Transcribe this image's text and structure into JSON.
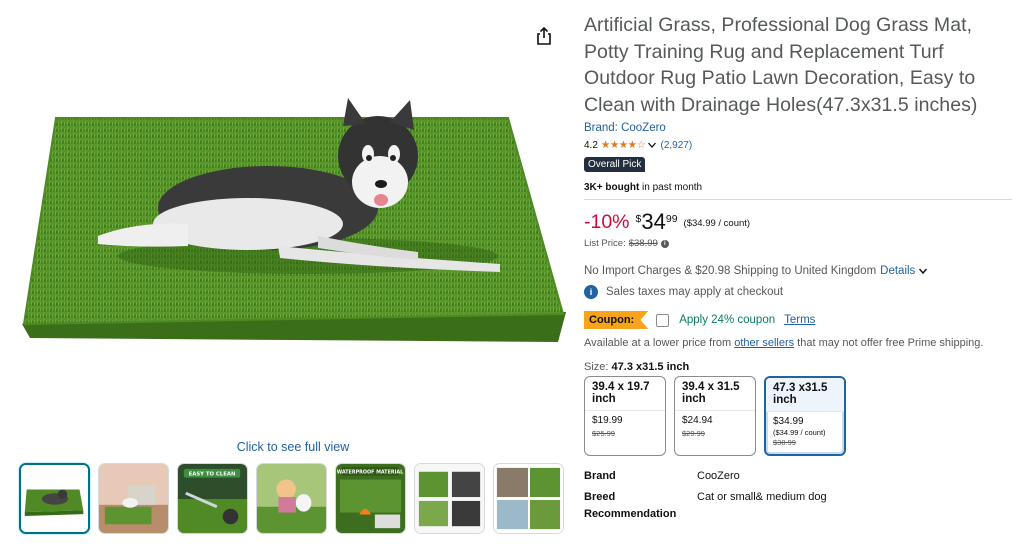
{
  "gallery": {
    "share_icon": "share-icon",
    "see_full_view": "Click to see full view",
    "thumbnails": [
      "thumbnail-1",
      "thumbnail-2",
      "thumbnail-3",
      "thumbnail-4",
      "thumbnail-5",
      "thumbnail-6",
      "thumbnail-7"
    ],
    "thumb3_text": "EASY TO CLEAN",
    "thumb5_text": "WATERPROOF MATERIAL"
  },
  "product": {
    "title": "Artificial Grass, Professional Dog Grass Mat, Potty Training Rug and Replacement Turf Outdoor Rug Patio Lawn Decoration, Easy to Clean with Drainage Holes(47.3x31.5 inches)",
    "brand_link": "Brand: CooZero",
    "rating": "4.2",
    "stars_value": 4.2,
    "rating_count": "(2,927)",
    "badge": "Overall Pick",
    "bought_bold": "3K+ bought",
    "bought_rest": " in past month"
  },
  "price": {
    "discount": "-10%",
    "currency": "$",
    "whole": "34",
    "fraction": "99",
    "per_count": "($34.99 / count)",
    "list_label": "List Price:",
    "list_value": "$38.99"
  },
  "shipping": {
    "text": "No Import Charges & $20.98 Shipping to United Kingdom",
    "details_link": "Details",
    "tax_text": "Sales taxes may apply at checkout"
  },
  "coupon": {
    "tag": "Coupon:",
    "apply_text": "Apply 24% coupon",
    "terms": "Terms"
  },
  "lower_price": {
    "prefix": "Available at a lower price from ",
    "link": "other sellers",
    "suffix": " that may not offer free Prime shipping."
  },
  "size": {
    "label": "Size:",
    "selected": "47.3 x31.5 inch",
    "options": [
      {
        "name": "39.4 x 19.7 inch",
        "price": "$19.99",
        "unit": "",
        "old": "$25.99"
      },
      {
        "name": "39.4 x 31.5 inch",
        "price": "$24.94",
        "unit": "",
        "old": "$29.99"
      },
      {
        "name": "47.3 x31.5 inch",
        "price": "$34.99",
        "unit": "($34.99 / count)",
        "old": "$38.99"
      }
    ]
  },
  "specs": [
    {
      "key": "Brand",
      "value": "CooZero"
    },
    {
      "key": "Breed Recommendation",
      "value": "Cat or small& medium dog"
    }
  ],
  "colors": {
    "link": "#2162a1",
    "discount": "#cc0c39",
    "star": "#de7921",
    "coupon": "#f7a31c",
    "coupon_green": "#067d62",
    "badge": "#232f3e"
  }
}
